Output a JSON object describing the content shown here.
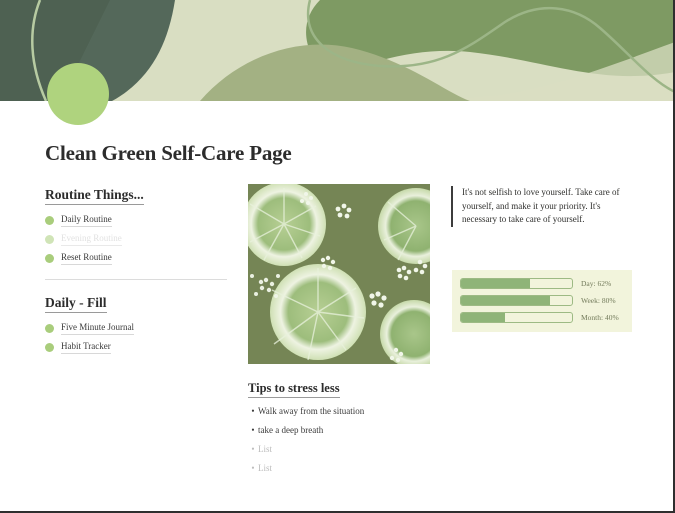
{
  "banner": {
    "colors": {
      "dark_green": "#4e6152",
      "olive": "#a3b183",
      "mid_green": "#7e9a63",
      "beige": "#d9dec2",
      "cream": "#e4e7d0",
      "line": "#9cb587",
      "circle": "#afd37e"
    },
    "avatar_name": "avatar-circle"
  },
  "title": "Clean Green Self-Care Page",
  "routine": {
    "heading": "Routine Things...",
    "items": [
      {
        "label": "Daily Routine",
        "faded": false
      },
      {
        "label": "Evening Routine",
        "faded": true
      },
      {
        "label": "Reset Routine",
        "faded": false
      }
    ]
  },
  "daily_fill": {
    "heading": "Daily - Fill",
    "items": [
      {
        "label": "Five Minute Journal",
        "faded": false
      },
      {
        "label": "Habit Tracker",
        "faded": false
      }
    ]
  },
  "photo": {
    "alt": "limes-and-white-flowers-photo"
  },
  "tips": {
    "heading": "Tips to stress less",
    "bullet": "•",
    "items": [
      {
        "label": "Walk away from the situation",
        "placeholder": false
      },
      {
        "label": "take a deep breath",
        "placeholder": false
      },
      {
        "label": "List",
        "placeholder": true
      },
      {
        "label": "List",
        "placeholder": true
      }
    ]
  },
  "quote": {
    "text": "It's not selfish to love yourself. Take care of yourself, and make it your priority. It's necessary to take care of yourself."
  },
  "progress": {
    "accent": "#8fb478",
    "card_bg": "#f2f4dc",
    "rows": [
      {
        "label": "Day: 62%",
        "value": 62
      },
      {
        "label": "Week: 80%",
        "value": 80
      },
      {
        "label": "Month: 40%",
        "value": 40
      }
    ]
  }
}
